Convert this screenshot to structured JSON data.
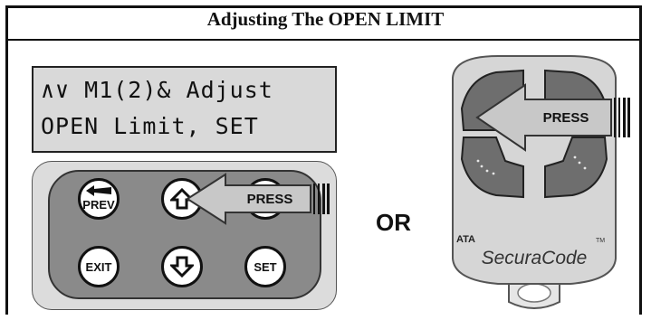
{
  "title": "Adjusting The OPEN LIMIT",
  "lcd": {
    "line1": "∧∨ M1(2)& Adjust",
    "line2": "OPEN Limit, SET"
  },
  "keypad": {
    "prev_label": "PREV",
    "exit_label": "EXIT",
    "set_label": "SET",
    "press_label": "PRESS"
  },
  "or_label": "OR",
  "remote": {
    "brand": "ATA",
    "tm": "TM",
    "model": "SecuraCode",
    "press_label": "PRESS"
  },
  "colors": {
    "keypad_body": "#8a8a8a",
    "lcd_background": "#d9d9d9",
    "arrow_fill": "#c8c8c8",
    "remote_body": "#d6d6d6",
    "remote_buttons": "#6e6e6e"
  }
}
